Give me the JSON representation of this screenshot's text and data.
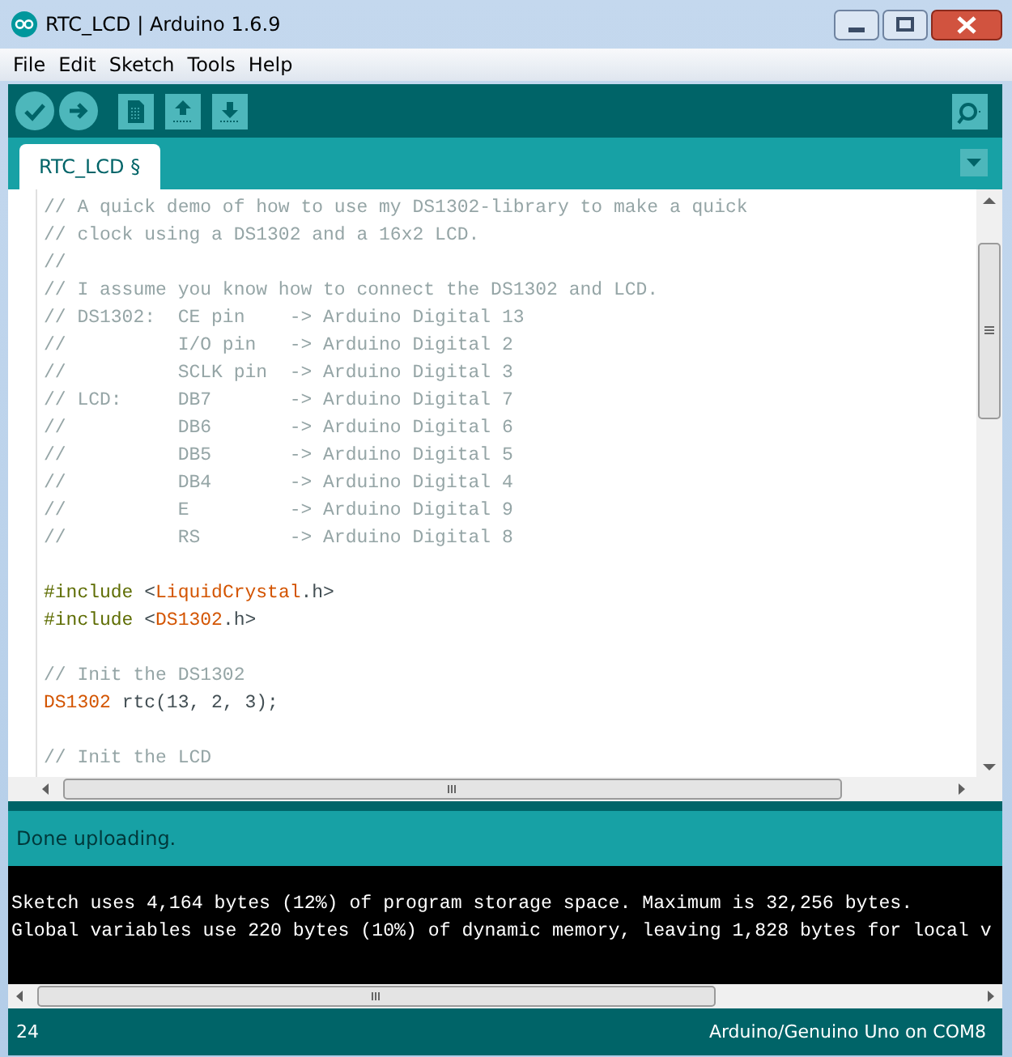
{
  "window": {
    "title": "RTC_LCD | Arduino 1.6.9"
  },
  "menu": [
    "File",
    "Edit",
    "Sketch",
    "Tools",
    "Help"
  ],
  "tabs": [
    {
      "label": "RTC_LCD §",
      "selected": true
    }
  ],
  "editor": {
    "lines": [
      {
        "kind": "code",
        "segments": [
          {
            "kind": "comment",
            "text": "// A quick demo of how to use my DS1302-library to make a quick"
          }
        ]
      },
      {
        "kind": "code",
        "segments": [
          {
            "kind": "comment",
            "text": "// clock using a DS1302 and a 16x2 LCD."
          }
        ]
      },
      {
        "kind": "code",
        "segments": [
          {
            "kind": "comment",
            "text": "//"
          }
        ]
      },
      {
        "kind": "code",
        "segments": [
          {
            "kind": "comment",
            "text": "// I assume you know how to connect the DS1302 and LCD."
          }
        ]
      },
      {
        "kind": "code",
        "segments": [
          {
            "kind": "comment",
            "text": "// DS1302:  CE pin    -> Arduino Digital 13"
          }
        ]
      },
      {
        "kind": "code",
        "segments": [
          {
            "kind": "comment",
            "text": "//          I/O pin   -> Arduino Digital 2"
          }
        ]
      },
      {
        "kind": "code",
        "segments": [
          {
            "kind": "comment",
            "text": "//          SCLK pin  -> Arduino Digital 3"
          }
        ]
      },
      {
        "kind": "code",
        "segments": [
          {
            "kind": "comment",
            "text": "// LCD:     DB7       -> Arduino Digital 7"
          }
        ]
      },
      {
        "kind": "code",
        "segments": [
          {
            "kind": "comment",
            "text": "//          DB6       -> Arduino Digital 6"
          }
        ]
      },
      {
        "kind": "code",
        "segments": [
          {
            "kind": "comment",
            "text": "//          DB5       -> Arduino Digital 5"
          }
        ]
      },
      {
        "kind": "code",
        "segments": [
          {
            "kind": "comment",
            "text": "//          DB4       -> Arduino Digital 4"
          }
        ]
      },
      {
        "kind": "code",
        "segments": [
          {
            "kind": "comment",
            "text": "//          E         -> Arduino Digital 9"
          }
        ]
      },
      {
        "kind": "code",
        "segments": [
          {
            "kind": "comment",
            "text": "//          RS        -> Arduino Digital 8"
          }
        ]
      },
      {
        "kind": "blank"
      },
      {
        "kind": "code",
        "segments": [
          {
            "kind": "preprocessor",
            "text": "#include"
          },
          {
            "kind": "plain",
            "text": " <"
          },
          {
            "kind": "keyword",
            "text": "LiquidCrystal"
          },
          {
            "kind": "plain",
            "text": ".h>"
          }
        ]
      },
      {
        "kind": "code",
        "segments": [
          {
            "kind": "preprocessor",
            "text": "#include"
          },
          {
            "kind": "plain",
            "text": " <"
          },
          {
            "kind": "keyword",
            "text": "DS1302"
          },
          {
            "kind": "plain",
            "text": ".h>"
          }
        ]
      },
      {
        "kind": "blank"
      },
      {
        "kind": "code",
        "segments": [
          {
            "kind": "comment",
            "text": "// Init the DS1302"
          }
        ]
      },
      {
        "kind": "code",
        "segments": [
          {
            "kind": "keyword",
            "text": "DS1302"
          },
          {
            "kind": "plain",
            "text": " rtc(13, 2, 3);"
          }
        ]
      },
      {
        "kind": "blank"
      },
      {
        "kind": "code",
        "segments": [
          {
            "kind": "comment",
            "text": "// Init the LCD"
          }
        ]
      }
    ]
  },
  "status": {
    "message": "Done uploading."
  },
  "console": {
    "lines": [
      "Sketch uses 4,164 bytes (12%) of program storage space. Maximum is 32,256 bytes.",
      "Global variables use 220 bytes (10%) of dynamic memory, leaving 1,828 bytes for local v"
    ]
  },
  "footer": {
    "line_number": "24",
    "board": "Arduino/Genuino Uno on COM8"
  }
}
